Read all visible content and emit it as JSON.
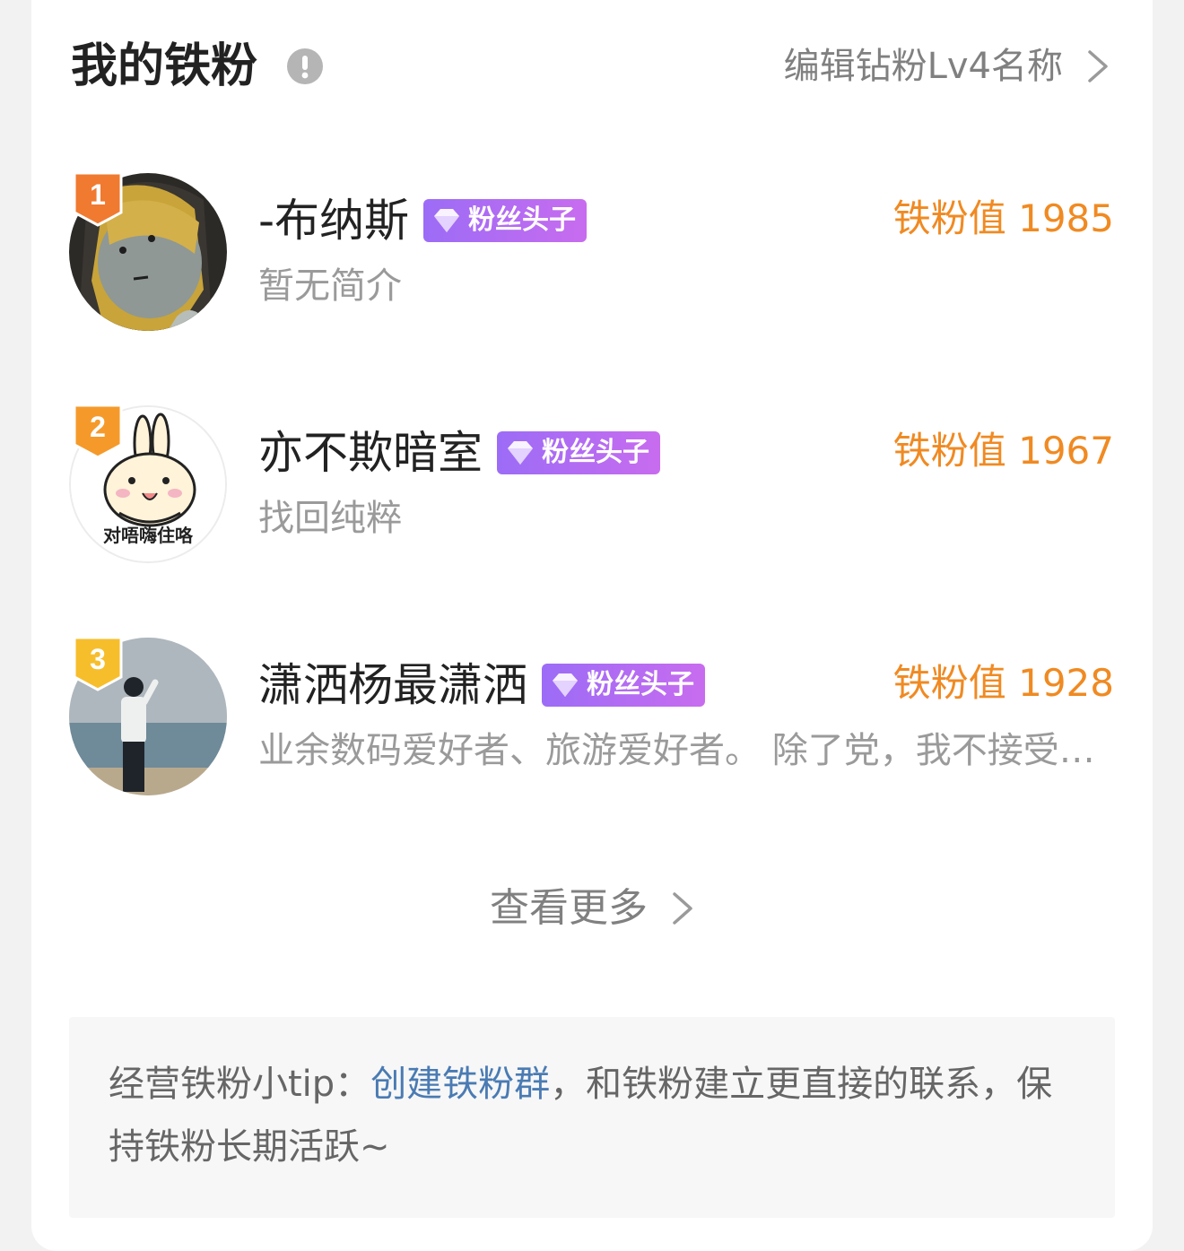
{
  "header": {
    "title": "我的铁粉",
    "link_text": "编辑钻粉Lv4名称"
  },
  "fans": [
    {
      "rank": "1",
      "name": "-布纳斯",
      "tag": "粉丝头子",
      "score": "铁粉值 1985",
      "bio": "暂无简介",
      "badge_color": "#f07a30"
    },
    {
      "rank": "2",
      "name": "亦不欺暗室",
      "tag": "粉丝头子",
      "score": "铁粉值 1967",
      "bio": "找回纯粹",
      "badge_color": "#f59a2a",
      "avatar_caption": "对唔嗨住咯"
    },
    {
      "rank": "3",
      "name": "潇洒杨最潇洒",
      "tag": "粉丝头子",
      "score": "铁粉值 1928",
      "bio": "业余数码爱好者、旅游爱好者。 除了党，我不接受任何组织的领导",
      "badge_color": "#f7be2c"
    }
  ],
  "more_label": "查看更多",
  "tip": {
    "prefix": "经营铁粉小tip：",
    "link": "创建铁粉群",
    "suffix": "，和铁粉建立更直接的联系，保持铁粉长期活跃~"
  },
  "colors": {
    "score": "#f08a22",
    "tag_gradient_start": "#9c6cf6",
    "tag_gradient_end": "#c86cef",
    "link": "#4a7bb3"
  }
}
